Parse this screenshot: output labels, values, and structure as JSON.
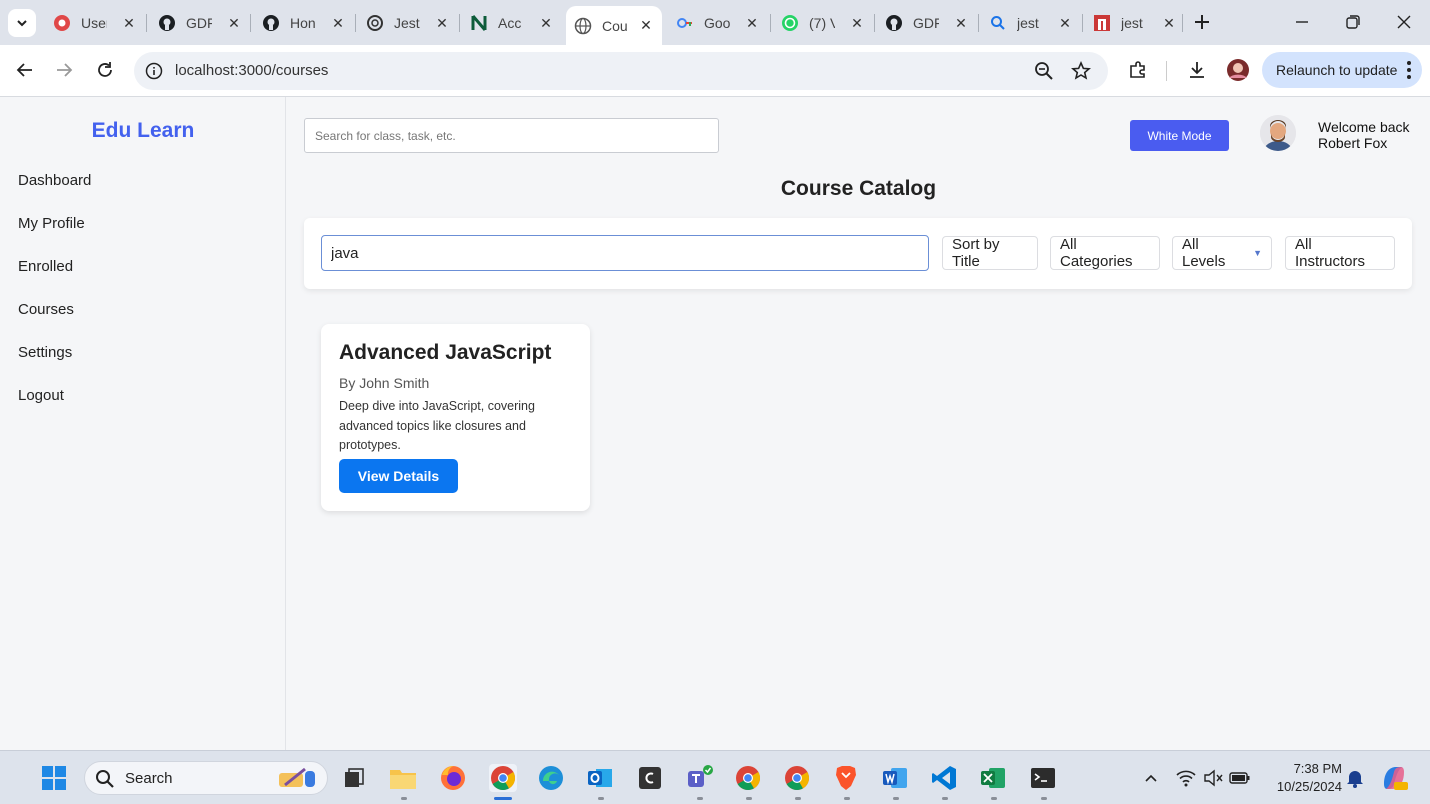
{
  "browser": {
    "tabs": [
      {
        "title": "User",
        "icon": "gear-red-icon"
      },
      {
        "title": "GDF",
        "icon": "github-icon"
      },
      {
        "title": "Hon",
        "icon": "github-icon"
      },
      {
        "title": "Jest",
        "icon": "openai-icon"
      },
      {
        "title": "Acc",
        "icon": "notion-icon"
      },
      {
        "title": "Cou",
        "icon": "globe-icon",
        "active": true
      },
      {
        "title": "Goo",
        "icon": "google-icon"
      },
      {
        "title": "(7) V",
        "icon": "whatsapp-icon"
      },
      {
        "title": "GDF",
        "icon": "github-icon"
      },
      {
        "title": "jest",
        "icon": "search-icon"
      },
      {
        "title": "jest",
        "icon": "npm-icon"
      }
    ],
    "url": "localhost:3000/courses",
    "relaunch_label": "Relaunch to update"
  },
  "app": {
    "brand": "Edu Learn",
    "nav": [
      "Dashboard",
      "My Profile",
      "Enrolled",
      "Courses",
      "Settings",
      "Logout"
    ],
    "top_search_placeholder": "Search for class, task, etc.",
    "mode_button": "White Mode",
    "welcome_line1": "Welcome back",
    "welcome_line2": "Robert Fox",
    "page_title": "Course Catalog",
    "filters": {
      "search_value": "java",
      "sort": "Sort by Title",
      "categories": "All Categories",
      "levels": "All Levels",
      "instructors": "All Instructors"
    },
    "courses": [
      {
        "title": "Advanced JavaScript",
        "author": "By John Smith",
        "description": "Deep dive into JavaScript, covering advanced topics like closures and prototypes.",
        "button": "View Details"
      }
    ],
    "accent_color": "#4361ee",
    "button_color": "#0b76f0"
  },
  "taskbar": {
    "search_label": "Search",
    "time": "7:38 PM",
    "date": "10/25/2024"
  }
}
